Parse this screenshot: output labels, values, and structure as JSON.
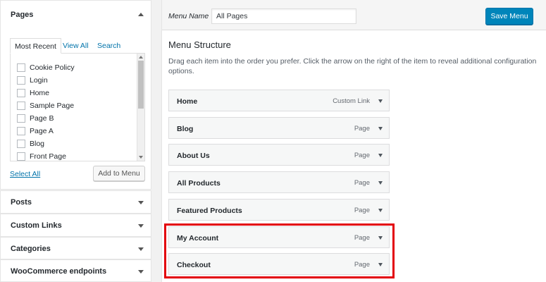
{
  "sidebar": {
    "pages": {
      "title": "Pages",
      "tabs": [
        "Most Recent",
        "View All",
        "Search"
      ],
      "items": [
        "Cookie Policy",
        "Login",
        "Home",
        "Sample Page",
        "Page B",
        "Page A",
        "Blog",
        "Front Page"
      ],
      "select_all": "Select All",
      "add_to_menu": "Add to Menu"
    },
    "sections": [
      "Posts",
      "Custom Links",
      "Categories",
      "WooCommerce endpoints"
    ]
  },
  "header": {
    "menu_name_label": "Menu Name",
    "menu_name_value": "All Pages",
    "save_label": "Save Menu"
  },
  "structure": {
    "title": "Menu Structure",
    "instructions": "Drag each item into the order you prefer. Click the arrow on the right of the item to reveal additional configuration options.",
    "items": [
      {
        "title": "Home",
        "type": "Custom Link"
      },
      {
        "title": "Blog",
        "type": "Page"
      },
      {
        "title": "About Us",
        "type": "Page"
      },
      {
        "title": "All Products",
        "type": "Page"
      },
      {
        "title": "Featured Products",
        "type": "Page"
      },
      {
        "title": "My Account",
        "type": "Page"
      },
      {
        "title": "Checkout",
        "type": "Page"
      }
    ]
  },
  "colors": {
    "primary_button": "#0085ba",
    "link": "#0073aa",
    "highlight": "#e3000b"
  }
}
